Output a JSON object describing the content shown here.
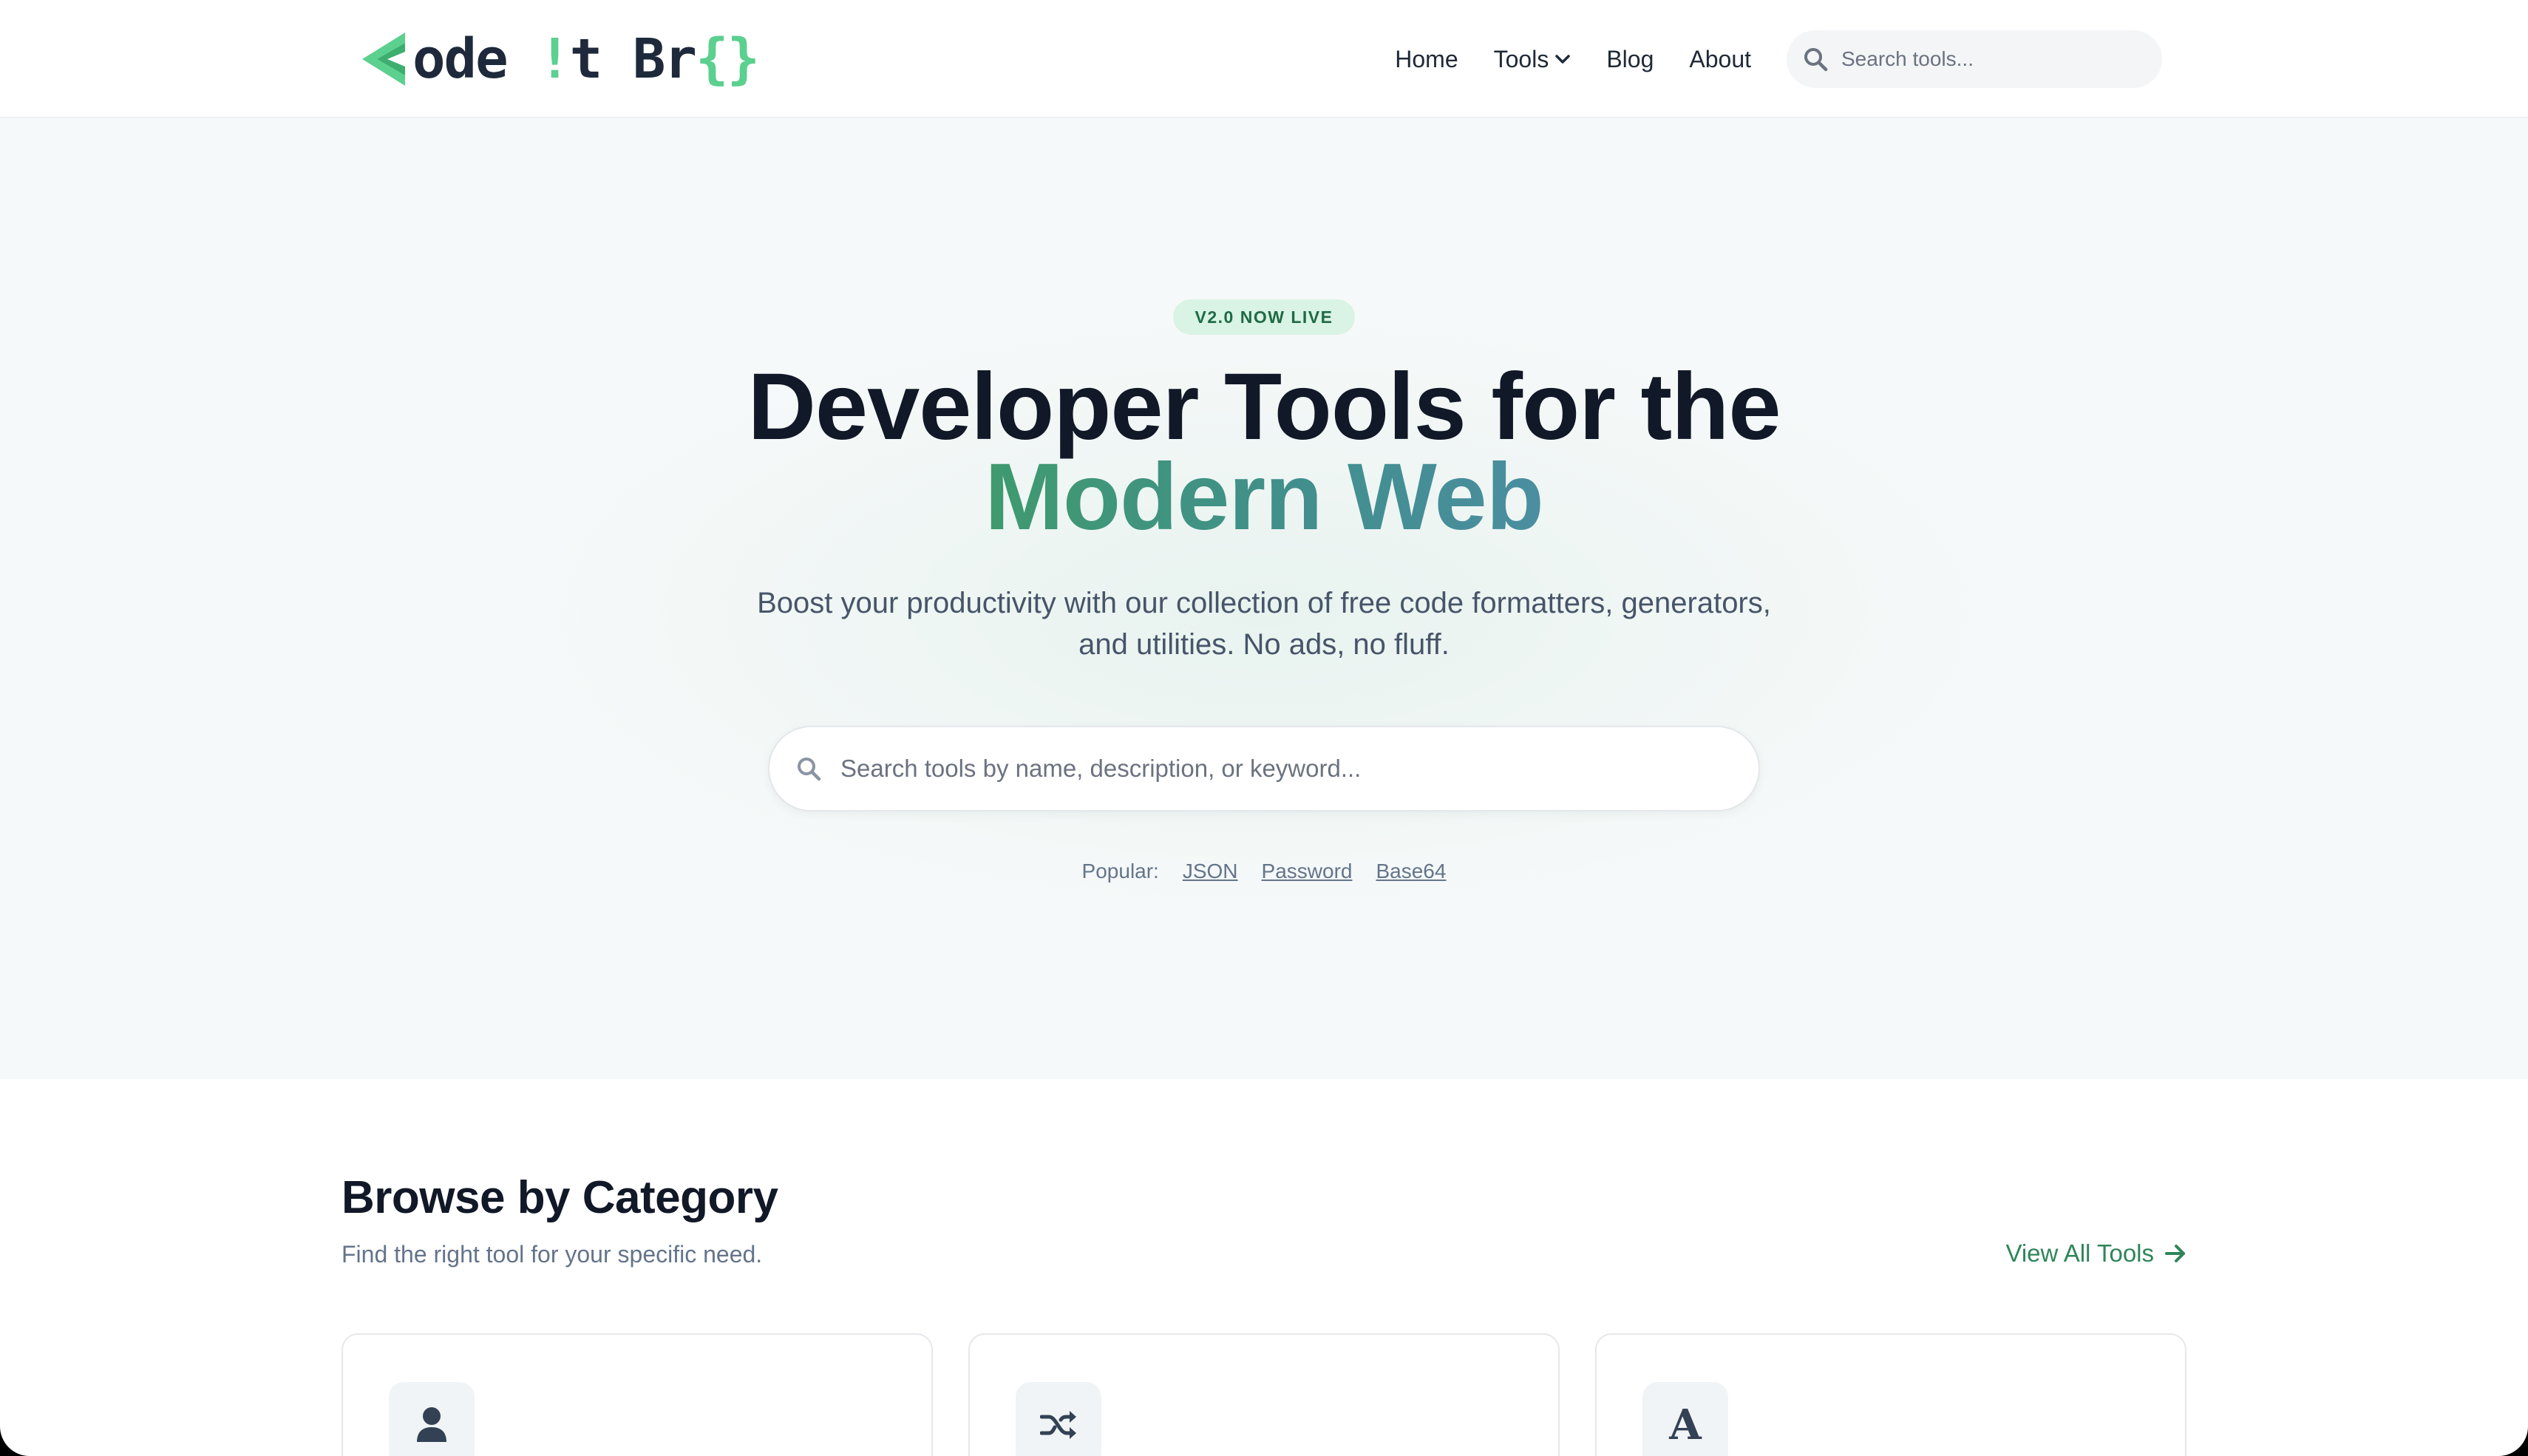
{
  "header": {
    "logo": {
      "text_main": "ode ",
      "text_bang": "!",
      "text_t": "t Br",
      "text_braces": "{}",
      "accent_color": "#5bd08f"
    },
    "nav": {
      "home": "Home",
      "tools": "Tools",
      "blog": "Blog",
      "about": "About"
    },
    "search": {
      "placeholder": "Search tools..."
    }
  },
  "hero": {
    "badge": "V2.0 NOW LIVE",
    "title_line1": "Developer Tools for the",
    "title_line2": "Modern Web",
    "subtitle": "Boost your productivity with our collection of free code formatters, generators, and utilities. No ads, no fluff.",
    "search_placeholder": "Search tools by name, description, or keyword...",
    "popular_label": "Popular:",
    "popular_links": [
      "JSON",
      "Password",
      "Base64"
    ]
  },
  "categories": {
    "title": "Browse by Category",
    "subtitle": "Find the right tool for your specific need.",
    "view_all": "View All Tools",
    "cards": [
      {
        "icon": "user-icon"
      },
      {
        "icon": "shuffle-icon"
      },
      {
        "icon": "font-icon",
        "letter": "A"
      }
    ]
  },
  "colors": {
    "brand_green": "#2f855a",
    "badge_bg": "#d9f3e4",
    "heading": "#111827"
  }
}
